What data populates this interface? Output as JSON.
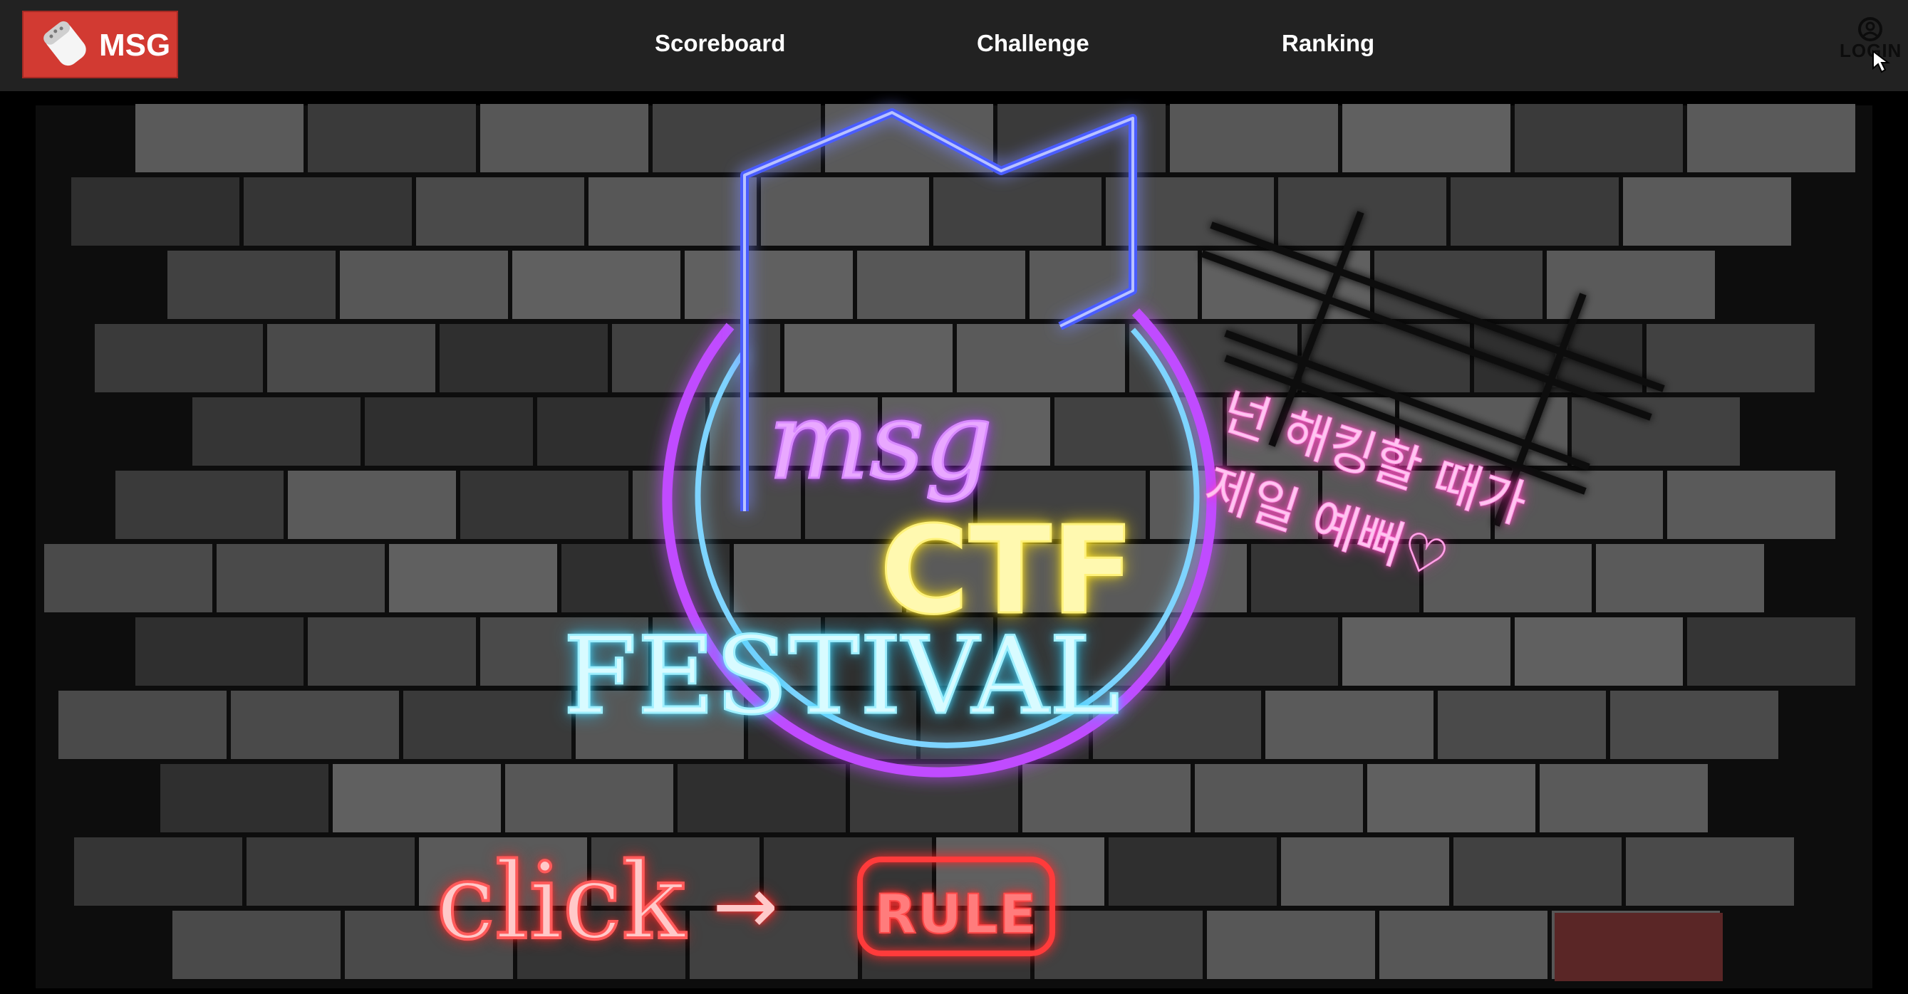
{
  "header": {
    "logo_text": "MSG",
    "nav": [
      {
        "label": "Scoreboard"
      },
      {
        "label": "Challenge"
      },
      {
        "label": "Ranking"
      }
    ],
    "login_label": "LOGIN",
    "login_icon": "user-circle-icon"
  },
  "hero": {
    "sign_msg": "msg",
    "sign_ctf": "CTF",
    "sign_festival": "FESTIVAL",
    "korean_line_1": "넌 해킹할 때가",
    "korean_line_2": "제일 예뻐♡",
    "click_text": "click",
    "arrow_text": "→",
    "rule_button_label": "RULE"
  },
  "colors": {
    "navbar_bg": "#222222",
    "logo_bg": "#d23a32",
    "wall_bg": "#000000",
    "neon_blue": "#4a5cff",
    "neon_purple": "#c04cff",
    "neon_cyan": "#5be0ff",
    "neon_yellow": "#ffe83a",
    "neon_pink": "#ff4fc4",
    "neon_red": "#ff3b3b"
  }
}
